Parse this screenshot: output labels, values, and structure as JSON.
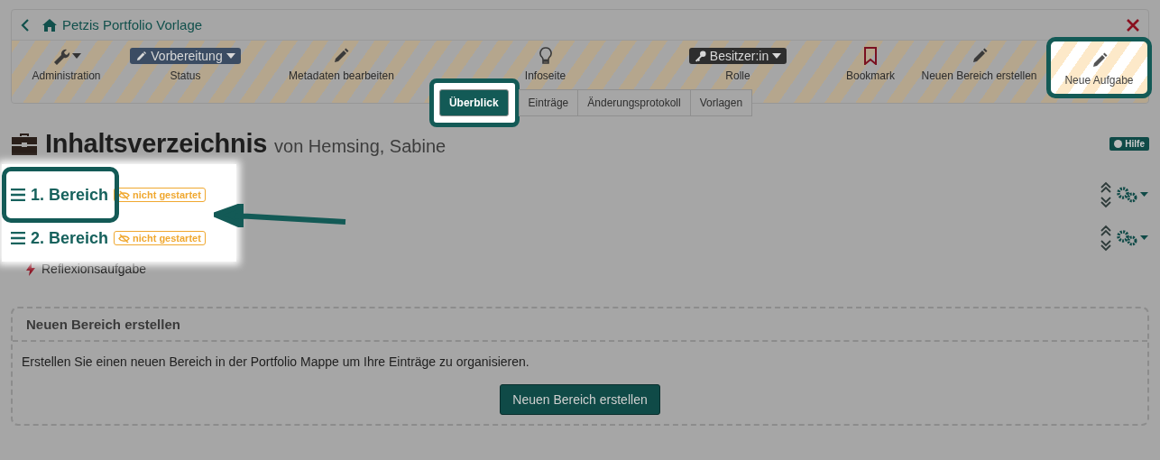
{
  "header": {
    "title": "Petzis Portfolio Vorlage"
  },
  "toolbar": [
    {
      "kind": "menu",
      "label": "Administration",
      "highlighted": false
    },
    {
      "kind": "badge",
      "badge": "Vorbereitung",
      "label": "Status",
      "color": "#3b4c63",
      "highlighted": false
    },
    {
      "kind": "action",
      "label": "Metadaten bearbeiten",
      "highlighted": false
    },
    {
      "kind": "action",
      "label": "Infoseite",
      "highlighted": false
    },
    {
      "kind": "badge",
      "badge": "Besitzer:in",
      "label": "Rolle",
      "color": "#2e2e2e",
      "highlighted": false
    },
    {
      "kind": "action",
      "label": "Bookmark",
      "highlighted": false
    },
    {
      "kind": "action",
      "label": "Neuen Bereich erstellen",
      "highlighted": false
    },
    {
      "kind": "action",
      "label": "Neue Aufgabe",
      "highlighted": true
    }
  ],
  "tabs": [
    {
      "label": "Überblick",
      "selected": true,
      "highlighted": true
    },
    {
      "label": "Einträge",
      "selected": false,
      "highlighted": false
    },
    {
      "label": "Änderungsprotokoll",
      "selected": false,
      "highlighted": false
    },
    {
      "label": "Vorlagen",
      "selected": false,
      "highlighted": false
    }
  ],
  "page": {
    "title": "Inhaltsverzeichnis",
    "owner": "von Hemsing, Sabine",
    "help": "Hilfe"
  },
  "sections": [
    {
      "title": "1. Bereich",
      "status": "nicht gestartet",
      "highlighted": true
    },
    {
      "title": "2. Bereich",
      "status": "nicht gestartet",
      "highlighted": false
    }
  ],
  "assignments": [
    {
      "title": "Reflexionsaufgabe"
    }
  ],
  "create_panel": {
    "title": "Neuen Bereich erstellen",
    "text": "Erstellen Sie einen neuen Bereich in der Portfolio Mappe um Ihre Einträge zu organisieren.",
    "button": "Neuen Bereich erstellen"
  }
}
